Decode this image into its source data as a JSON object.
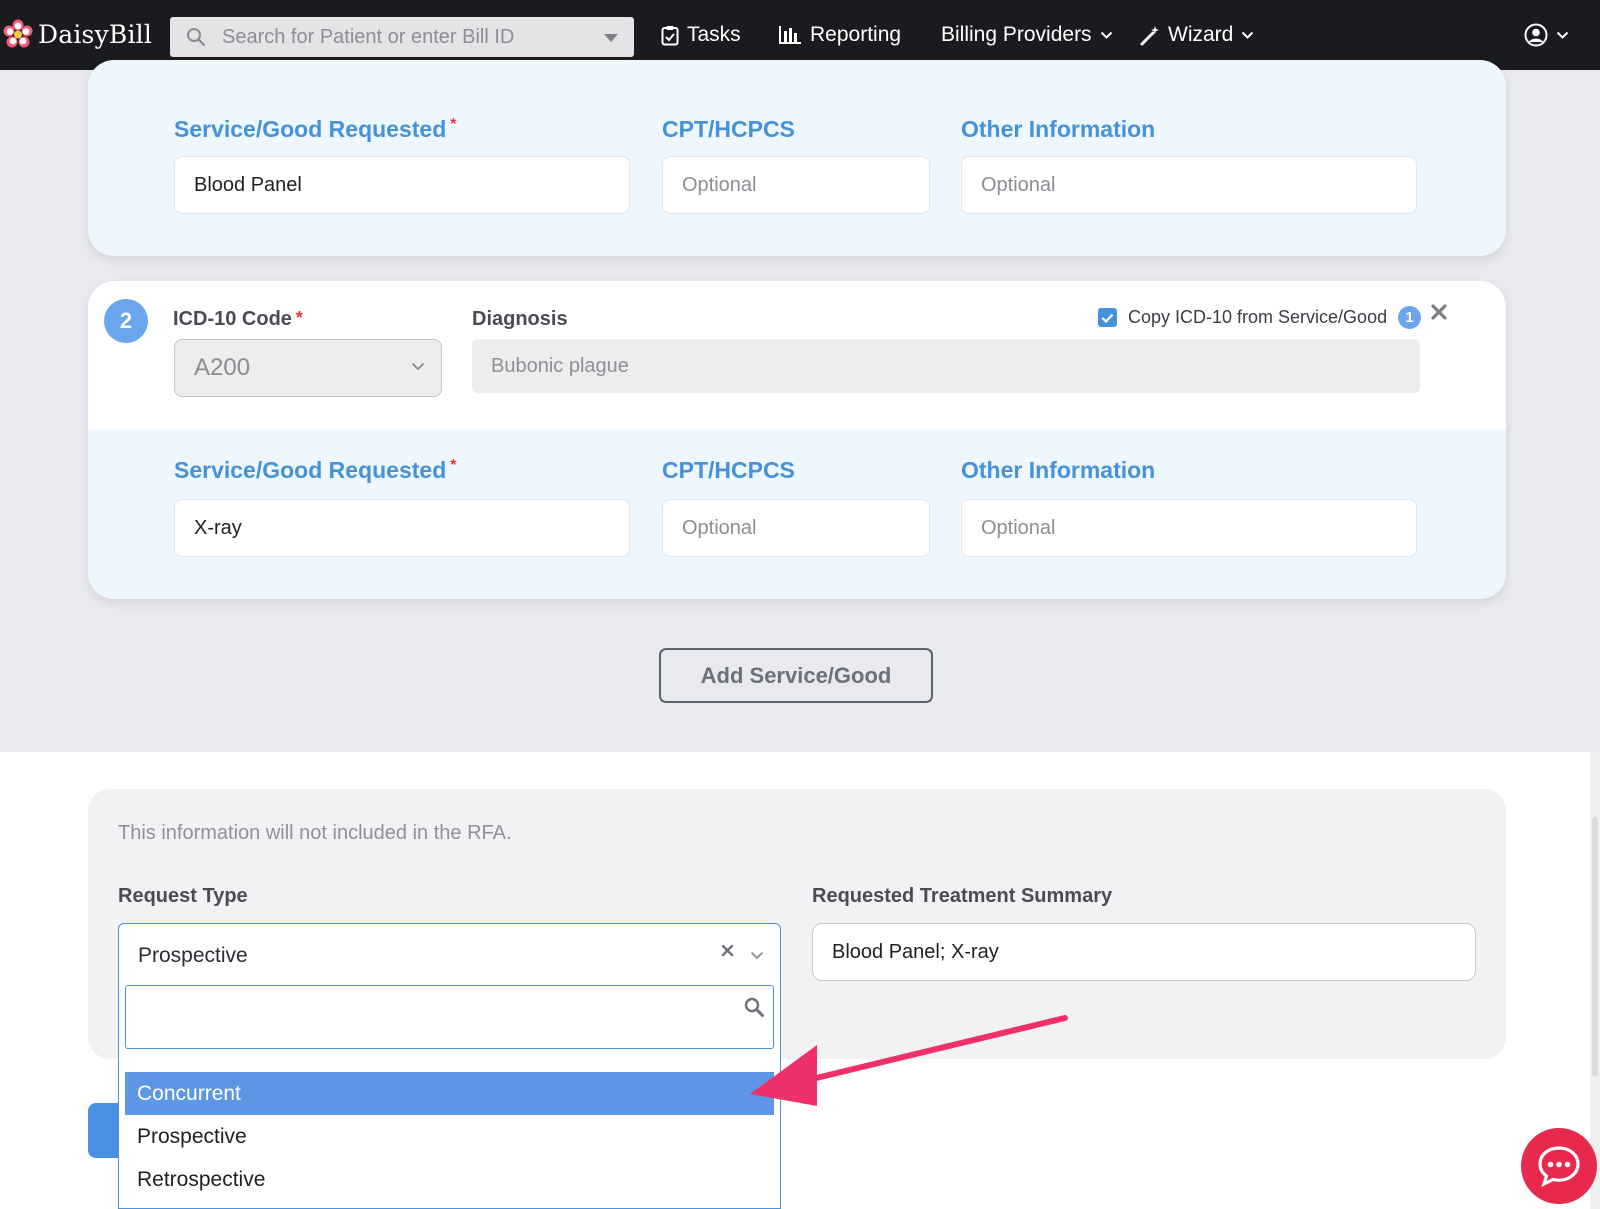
{
  "nav": {
    "brand": "DaisyBill",
    "search_placeholder": "Search for Patient or enter Bill ID",
    "tasks": "Tasks",
    "reporting": "Reporting",
    "billing_providers": "Billing Providers",
    "wizard": "Wizard"
  },
  "item1": {
    "service_label": "Service/Good Requested",
    "service_value": "Blood Panel",
    "cpt_label": "CPT/HCPCS",
    "cpt_placeholder": "Optional",
    "other_label": "Other Information",
    "other_placeholder": "Optional"
  },
  "item2": {
    "number": "2",
    "icd_label": "ICD-10 Code",
    "icd_value": "A200",
    "diagnosis_label": "Diagnosis",
    "diagnosis_value": "Bubonic plague",
    "copy_label": "Copy ICD-10 from Service/Good",
    "copy_ref": "1",
    "copy_checked": true,
    "service_label": "Service/Good Requested",
    "service_value": "X-ray",
    "cpt_label": "CPT/HCPCS",
    "cpt_placeholder": "Optional",
    "other_label": "Other Information",
    "other_placeholder": "Optional"
  },
  "add_button": "Add Service/Good",
  "meta": {
    "note": "This information will not included in the RFA.",
    "request_type_label": "Request Type",
    "request_type_value": "Prospective",
    "summary_label": "Requested Treatment Summary",
    "summary_value": "Blood Panel; X-ray",
    "options": [
      "Concurrent",
      "Prospective",
      "Retrospective"
    ],
    "highlighted_option": "Concurrent"
  },
  "colors": {
    "accent": "#4591da",
    "highlight": "#5e96e6",
    "required": "#e23b3b",
    "annotation_arrow": "#f0306a",
    "chat": "#e8294e"
  }
}
